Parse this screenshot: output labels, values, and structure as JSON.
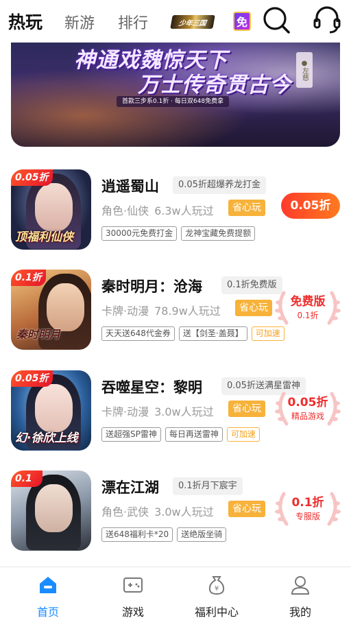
{
  "header": {
    "tabs": [
      {
        "label": "热玩",
        "active": true
      },
      {
        "label": "新游",
        "active": false
      },
      {
        "label": "排行",
        "active": false
      }
    ],
    "logo_a_text": "少年三国",
    "logo_b_text": "免",
    "icons": [
      "search-icon",
      "headset-icon"
    ]
  },
  "banner": {
    "title_line1": "神通戏魏惊天下",
    "title_line2": "万士传奇贯古今",
    "subtitle": "首款三步系0.1折 · 每日双648免费拿",
    "side_badge": "●左慈"
  },
  "games": [
    {
      "name": "逍遥蜀山",
      "promo": "0.05折超爆养龙打金",
      "genre": "角色·仙侠",
      "players": "6.3w人玩过",
      "worry_label": "省心玩",
      "tags": [
        "30000元免费打金",
        "龙神宝藏免费提额"
      ],
      "corner": "0.05折",
      "thumb_caption": "顶福利仙侠",
      "action": {
        "type": "pill",
        "label": "0.05折"
      }
    },
    {
      "name": "秦时明月：沧海",
      "promo": "0.1折免费版",
      "genre": "卡牌·动漫",
      "players": "78.9w人玩过",
      "worry_label": "省心玩",
      "tags": [
        "天天送648代金券",
        "送【剑圣·盖聂】"
      ],
      "accel": "可加速",
      "corner": "0.1折",
      "thumb_caption": "秦时明月",
      "action": {
        "type": "laurel",
        "big": "免费版",
        "small": "0.1折"
      }
    },
    {
      "name": "吞噬星空：黎明",
      "promo": "0.05折送满星雷神",
      "genre": "卡牌·动漫",
      "players": "3.0w人玩过",
      "worry_label": "省心玩",
      "tags": [
        "送超强SP雷神",
        "每日再送雷神"
      ],
      "accel": "可加速",
      "corner": "0.05折",
      "thumb_caption": "幻·徐欣上线",
      "action": {
        "type": "laurel",
        "big": "0.05折",
        "small": "精品游戏"
      }
    },
    {
      "name": "漂在江湖",
      "promo": "0.1折月下宸宇",
      "genre": "角色·武侠",
      "players": "3.0w人玩过",
      "worry_label": "省心玩",
      "tags": [
        "送648福利卡*20",
        "送绝版坐骑"
      ],
      "corner": "0.1",
      "thumb_caption": "",
      "action": {
        "type": "laurel",
        "big": "0.1折",
        "small": "专服版"
      }
    }
  ],
  "nav": [
    {
      "label": "首页",
      "icon": "home-icon",
      "active": true
    },
    {
      "label": "游戏",
      "icon": "gamepad-icon",
      "active": false
    },
    {
      "label": "福利中心",
      "icon": "money-bag-icon",
      "active": false
    },
    {
      "label": "我的",
      "icon": "user-icon",
      "active": false
    }
  ],
  "colors": {
    "accent": "#1a8cff",
    "discount_red": "#ee2d2d",
    "worry_orange": "#f7b23a"
  }
}
